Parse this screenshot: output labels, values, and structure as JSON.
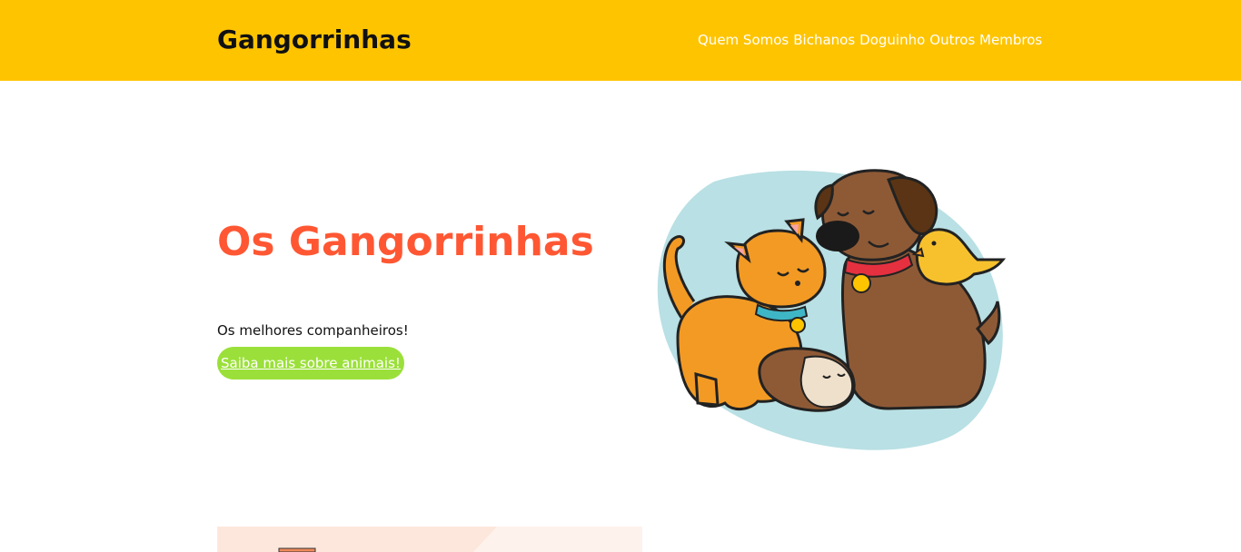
{
  "header": {
    "brand": "Gangorrinhas",
    "nav": [
      {
        "label": "Quem Somos"
      },
      {
        "label": "Bichanos"
      },
      {
        "label": "Doguinho"
      },
      {
        "label": "Outros Membros"
      }
    ]
  },
  "hero": {
    "title": "Os Gangorrinhas",
    "subtitle": "Os melhores companheiros!",
    "cta_label": "Saiba mais sobre animais!",
    "illustration": "pets-illustration"
  },
  "colors": {
    "header_bg": "#ffc400",
    "title": "#ff5733",
    "cta_bg": "#9be03a"
  }
}
